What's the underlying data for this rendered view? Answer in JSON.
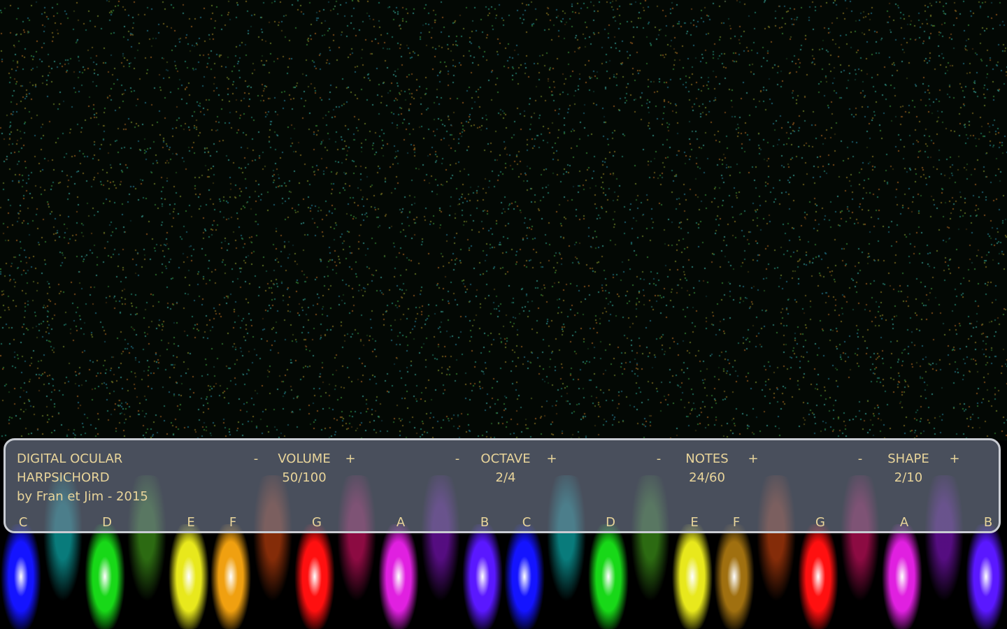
{
  "app": {
    "title_line1": "DIGITAL OCULAR",
    "title_line2": "HARPSICHORD",
    "credit": "by Fran et Jim - 2015"
  },
  "controls": [
    {
      "label": "VOLUME",
      "value": "50/100",
      "minus": "-",
      "plus": "+"
    },
    {
      "label": "OCTAVE",
      "value": "2/4",
      "minus": "-",
      "plus": "+"
    },
    {
      "label": "NOTES",
      "value": "24/60",
      "minus": "-",
      "plus": "+"
    },
    {
      "label": "SHAPE",
      "value": "2/10",
      "minus": "-",
      "plus": "+"
    }
  ],
  "note_labels": [
    "C",
    "D",
    "E",
    "F",
    "G",
    "A",
    "B",
    "C",
    "D",
    "E",
    "F",
    "G",
    "A",
    "B"
  ],
  "white_keys": [
    {
      "note": "C",
      "color": "#1414ff"
    },
    {
      "note": "D",
      "color": "#18d818"
    },
    {
      "note": "E",
      "color": "#e8e81c"
    },
    {
      "note": "F",
      "color": "#f0a010"
    },
    {
      "note": "G",
      "color": "#ff1010"
    },
    {
      "note": "A",
      "color": "#e020e0"
    },
    {
      "note": "B",
      "color": "#5a18ff"
    },
    {
      "note": "C",
      "color": "#1414ff"
    },
    {
      "note": "D",
      "color": "#18d818"
    },
    {
      "note": "E",
      "color": "#e8e81c"
    },
    {
      "note": "F",
      "color": "#a07010"
    },
    {
      "note": "G",
      "color": "#ff1010"
    },
    {
      "note": "A",
      "color": "#e020e0"
    },
    {
      "note": "B",
      "color": "#5a18ff"
    }
  ],
  "black_keys": [
    {
      "color": "#10e0e0"
    },
    {
      "color": "#50c020"
    },
    {
      "color": "#f05010"
    },
    {
      "color": "#ff1478"
    },
    {
      "color": "#9a18e8"
    },
    {
      "color": "#10e0e0"
    },
    {
      "color": "#50c020"
    },
    {
      "color": "#f05010"
    },
    {
      "color": "#ff1478"
    },
    {
      "color": "#9a18e8"
    }
  ],
  "accent_text_color": "#e8d49a",
  "panel_border_color": "#c9ccd3"
}
